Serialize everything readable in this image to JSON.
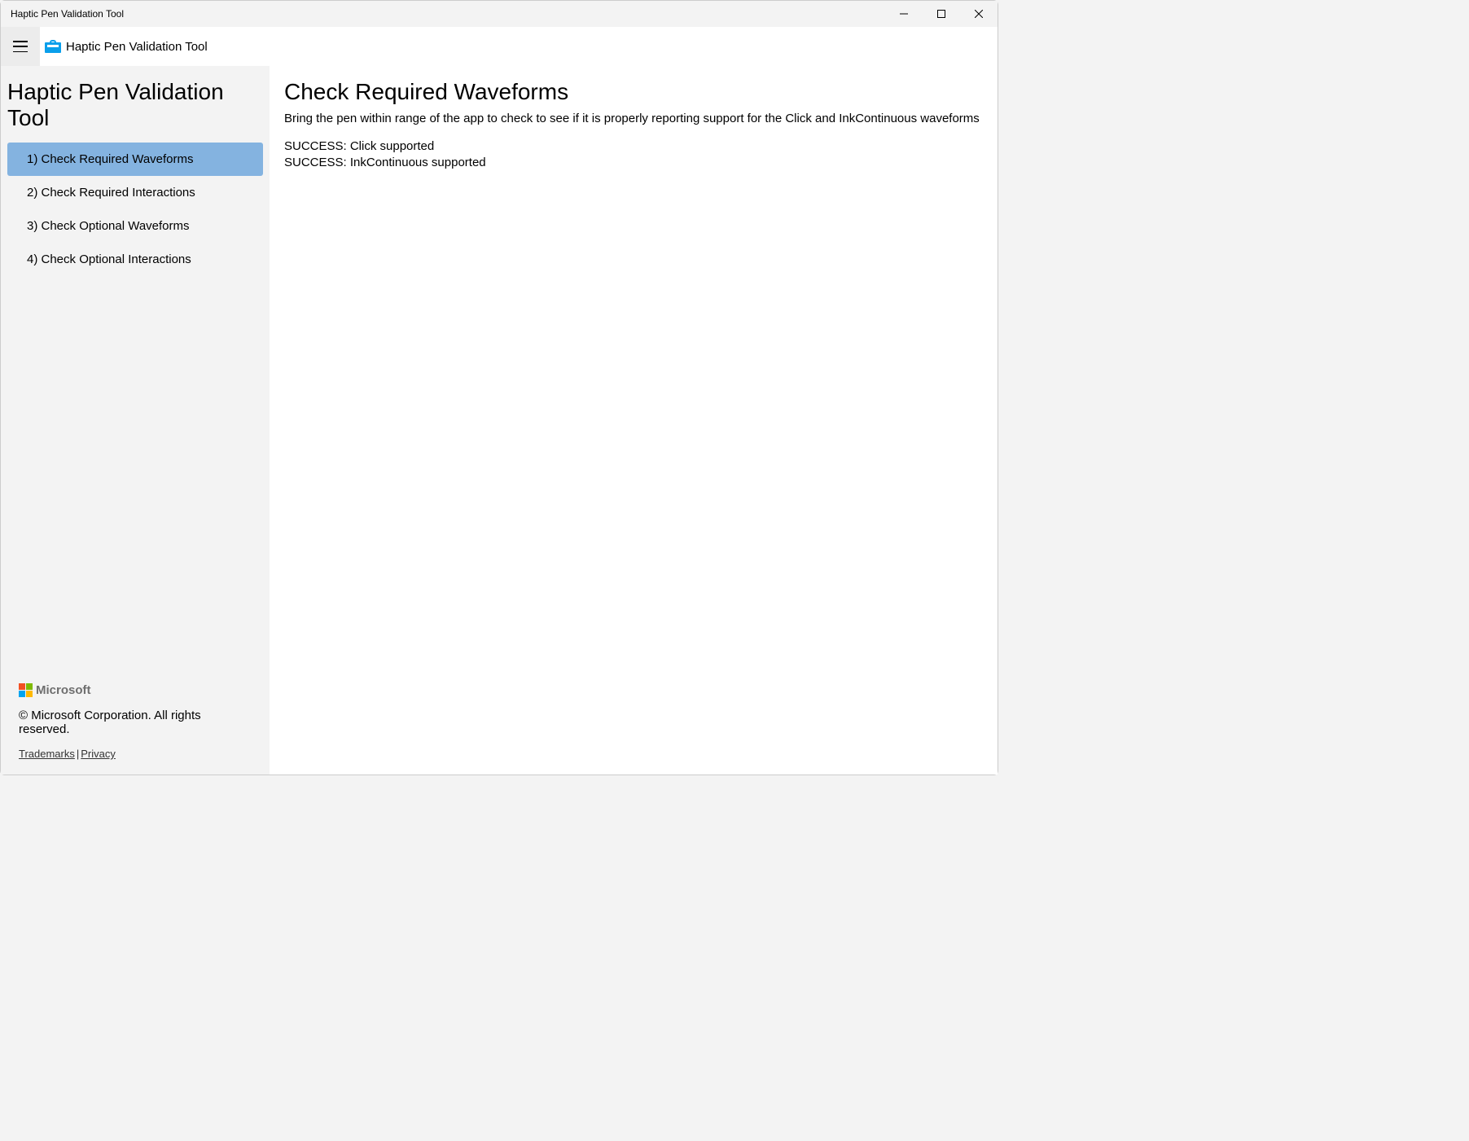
{
  "window": {
    "title": "Haptic Pen Validation Tool"
  },
  "header": {
    "app_title": "Haptic Pen Validation Tool"
  },
  "sidebar": {
    "title": "Haptic Pen Validation Tool",
    "items": [
      {
        "label": "1) Check Required Waveforms",
        "selected": true
      },
      {
        "label": "2) Check Required Interactions",
        "selected": false
      },
      {
        "label": "3) Check Optional Waveforms",
        "selected": false
      },
      {
        "label": "4) Check Optional Interactions",
        "selected": false
      }
    ],
    "footer": {
      "brand": "Microsoft",
      "copyright": "© Microsoft Corporation. All rights reserved.",
      "links": {
        "trademarks": "Trademarks",
        "privacy": "Privacy"
      }
    }
  },
  "main": {
    "heading": "Check Required Waveforms",
    "description": "Bring the pen within range of the app to check to see if it is properly reporting support for the Click and InkContinuous waveforms",
    "results": [
      "SUCCESS: Click supported",
      "SUCCESS: InkContinuous supported"
    ]
  }
}
